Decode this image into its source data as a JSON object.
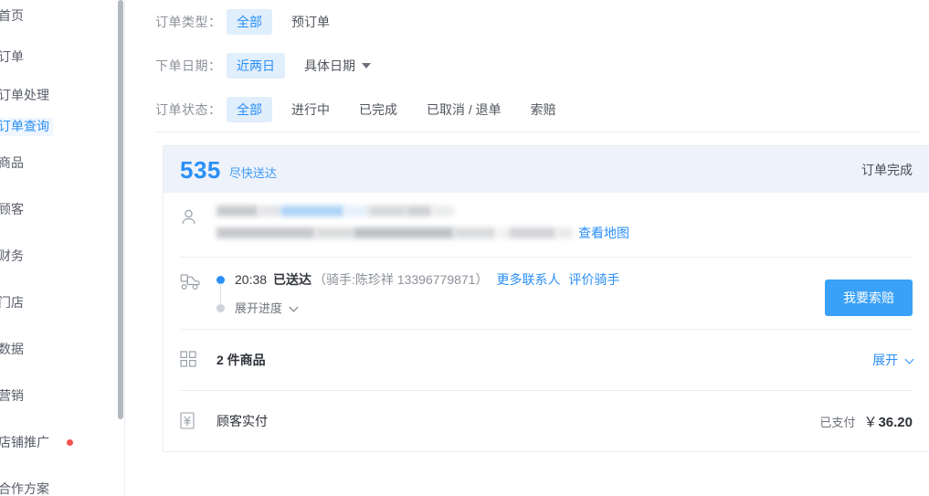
{
  "sidebar": {
    "items": [
      {
        "label": "首页",
        "name": "home",
        "active": false,
        "badge": false
      },
      {
        "label": "订单",
        "name": "orders",
        "active": false,
        "badge": false
      },
      {
        "label": "订单处理",
        "name": "order-processing",
        "active": false,
        "badge": false
      },
      {
        "label": "订单查询",
        "name": "order-query",
        "active": true,
        "badge": false
      },
      {
        "label": "商品",
        "name": "goods",
        "active": false,
        "badge": false
      },
      {
        "label": "顾客",
        "name": "customers",
        "active": false,
        "badge": false
      },
      {
        "label": "财务",
        "name": "finance",
        "active": false,
        "badge": false
      },
      {
        "label": "门店",
        "name": "stores",
        "active": false,
        "badge": false
      },
      {
        "label": "数据",
        "name": "data",
        "active": false,
        "badge": false
      },
      {
        "label": "营销",
        "name": "marketing",
        "active": false,
        "badge": false
      },
      {
        "label": "店铺推广",
        "name": "shop-promotion",
        "active": false,
        "badge": true
      },
      {
        "label": "合作方案",
        "name": "cooperation-plan",
        "active": false,
        "badge": false
      }
    ]
  },
  "filters": {
    "order_type": {
      "label": "订单类型：",
      "options": [
        "全部",
        "预订单"
      ],
      "selected": "全部"
    },
    "order_date": {
      "label": "下单日期：",
      "options": [
        "近两日",
        "具体日期"
      ],
      "selected": "近两日",
      "date_picker_label": "具体日期"
    },
    "order_status": {
      "label": "订单状态：",
      "options": [
        "全部",
        "进行中",
        "已完成",
        "已取消 / 退单",
        "索赔"
      ],
      "selected": "全部"
    }
  },
  "order": {
    "day_sequence": "535",
    "delivery_type": "尽快送达",
    "order_state": "订单完成",
    "customer": {
      "map_link": "查看地图"
    },
    "delivery": {
      "time": "20:38",
      "status": "已送达",
      "rider_info": "（骑手:陈珍祥 13396779871）",
      "more_contacts_link": "更多联系人",
      "rate_rider_link": "评价骑手",
      "expand_progress": "展开进度",
      "claim_button": "我要索赔"
    },
    "goods": {
      "summary": "2 件商品",
      "expand_link": "展开"
    },
    "payment": {
      "label": "顾客实付",
      "status": "已支付",
      "currency": "￥",
      "amount": "36.20"
    }
  },
  "colors": {
    "accent_blue": "#2a8ff7",
    "button_blue": "#39a1f7",
    "pill_active_bg": "#e1eefb",
    "card_head_bg": "#eef2fb",
    "badge_red": "#f6514f"
  }
}
